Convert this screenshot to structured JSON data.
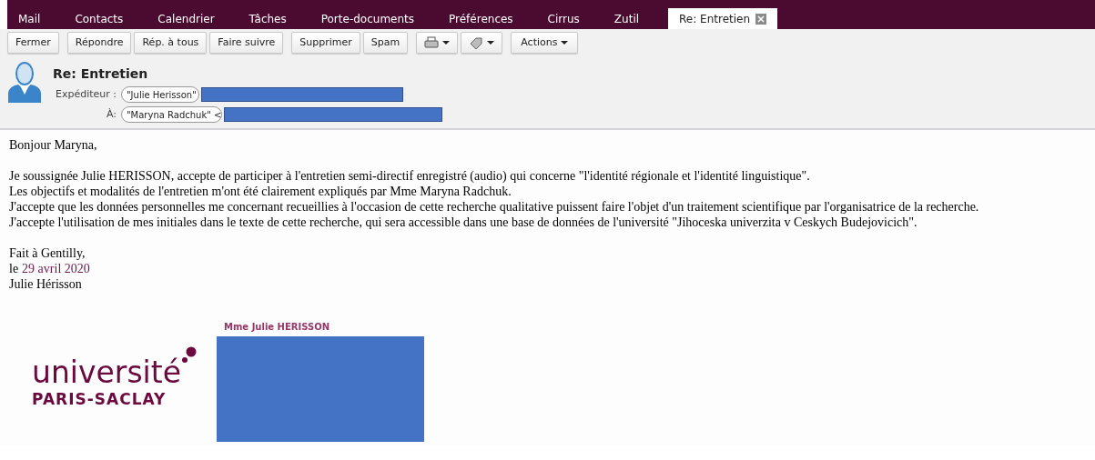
{
  "tabs": [
    {
      "label": "Mail",
      "selected": false,
      "closable": false
    },
    {
      "label": "Contacts",
      "selected": false,
      "closable": false
    },
    {
      "label": "Calendrier",
      "selected": false,
      "closable": false
    },
    {
      "label": "Tâches",
      "selected": false,
      "closable": false
    },
    {
      "label": "Porte-documents",
      "selected": false,
      "closable": false
    },
    {
      "label": "Préférences",
      "selected": false,
      "closable": false
    },
    {
      "label": "Cirrus",
      "selected": false,
      "closable": false
    },
    {
      "label": "Zutil",
      "selected": false,
      "closable": false
    },
    {
      "label": "Re: Entretien",
      "selected": true,
      "closable": true
    }
  ],
  "toolbar_groups": [
    [
      {
        "kind": "button",
        "label": "Fermer"
      }
    ],
    [
      {
        "kind": "button",
        "label": "Répondre"
      },
      {
        "kind": "button",
        "label": "Rép. à tous"
      },
      {
        "kind": "button",
        "label": "Faire suivre"
      }
    ],
    [
      {
        "kind": "button",
        "label": "Supprimer"
      },
      {
        "kind": "button",
        "label": "Spam"
      }
    ],
    [
      {
        "kind": "print-menu"
      },
      {
        "kind": "tag-menu"
      }
    ],
    [
      {
        "kind": "menu",
        "label": "Actions"
      }
    ]
  ],
  "message": {
    "subject": "Re: Entretien",
    "from": {
      "label": "Expéditeur :",
      "value": "\"Julie Herisson\""
    },
    "to": {
      "label": "À:",
      "value": "\"Maryna Radchuk\" <"
    }
  },
  "body": [
    {
      "lines": [
        {
          "text": "Bonjour Maryna,"
        }
      ]
    },
    {
      "lines": [
        {
          "text": "Je soussignée Julie HERISSON, accepte de participer à l'entretien semi-directif enregistré (audio) qui concerne \"l'identité régionale et l'identité linguistique\"."
        },
        {
          "text": "Les objectifs et modalités de l'entretien m'ont été clairement expliqués par Mme Maryna Radchuk."
        },
        {
          "text": "J'accepte que les données personnelles me concernant recueillies à l'occasion de cette recherche qualitative puissent faire l'objet d'un traitement scientifique par l'organisatrice de la recherche."
        },
        {
          "text": "J'accepte l'utilisation de mes initiales dans le texte de cette recherche, qui sera accessible dans une base de données de l'université \"Jihoceska univerzita v Ceskych Budejovicich\"."
        }
      ]
    },
    {
      "lines": [
        {
          "text": "Fait à Gentilly,"
        },
        {
          "text": "le",
          "date": "29 avril 2020"
        },
        {
          "text": "Julie Hérisson"
        }
      ]
    }
  ],
  "signature": {
    "name": "Mme Julie HERISSON",
    "logo": {
      "line_1": "université",
      "line_2": "PARIS-SACLAY"
    }
  }
}
